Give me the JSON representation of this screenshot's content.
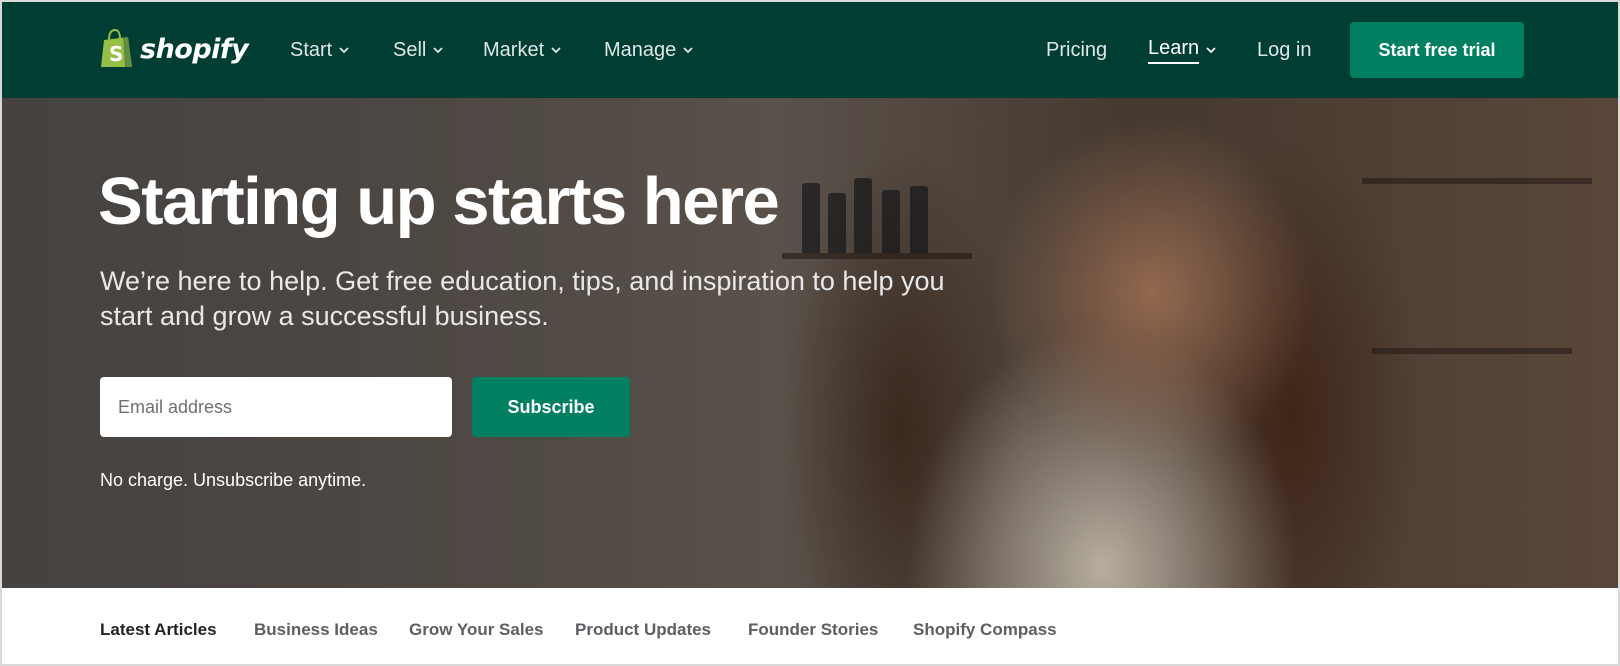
{
  "brand": {
    "logo_text": "shopify",
    "logo_icon": "shopping-bag-icon"
  },
  "nav": {
    "items": [
      {
        "label": "Start",
        "has_dropdown": true
      },
      {
        "label": "Sell",
        "has_dropdown": true
      },
      {
        "label": "Market",
        "has_dropdown": true
      },
      {
        "label": "Manage",
        "has_dropdown": true
      }
    ],
    "right": {
      "pricing": "Pricing",
      "learn": "Learn",
      "login": "Log in",
      "cta": "Start free trial"
    }
  },
  "hero": {
    "title": "Starting up starts here",
    "subtitle_line1": "We’re here to help. Get free education, tips, and inspiration to help you",
    "subtitle_line2": "start and grow a successful business.",
    "email_placeholder": "Email address",
    "subscribe_label": "Subscribe",
    "note": "No charge. Unsubscribe anytime."
  },
  "tabs": [
    {
      "label": "Latest Articles",
      "active": true
    },
    {
      "label": "Business Ideas",
      "active": false
    },
    {
      "label": "Grow Your Sales",
      "active": false
    },
    {
      "label": "Product Updates",
      "active": false
    },
    {
      "label": "Founder Stories",
      "active": false
    },
    {
      "label": "Shopify Compass",
      "active": false
    }
  ],
  "colors": {
    "nav_bg": "#003d33",
    "brand_green": "#008060",
    "logo_bag": "#95bf47"
  }
}
